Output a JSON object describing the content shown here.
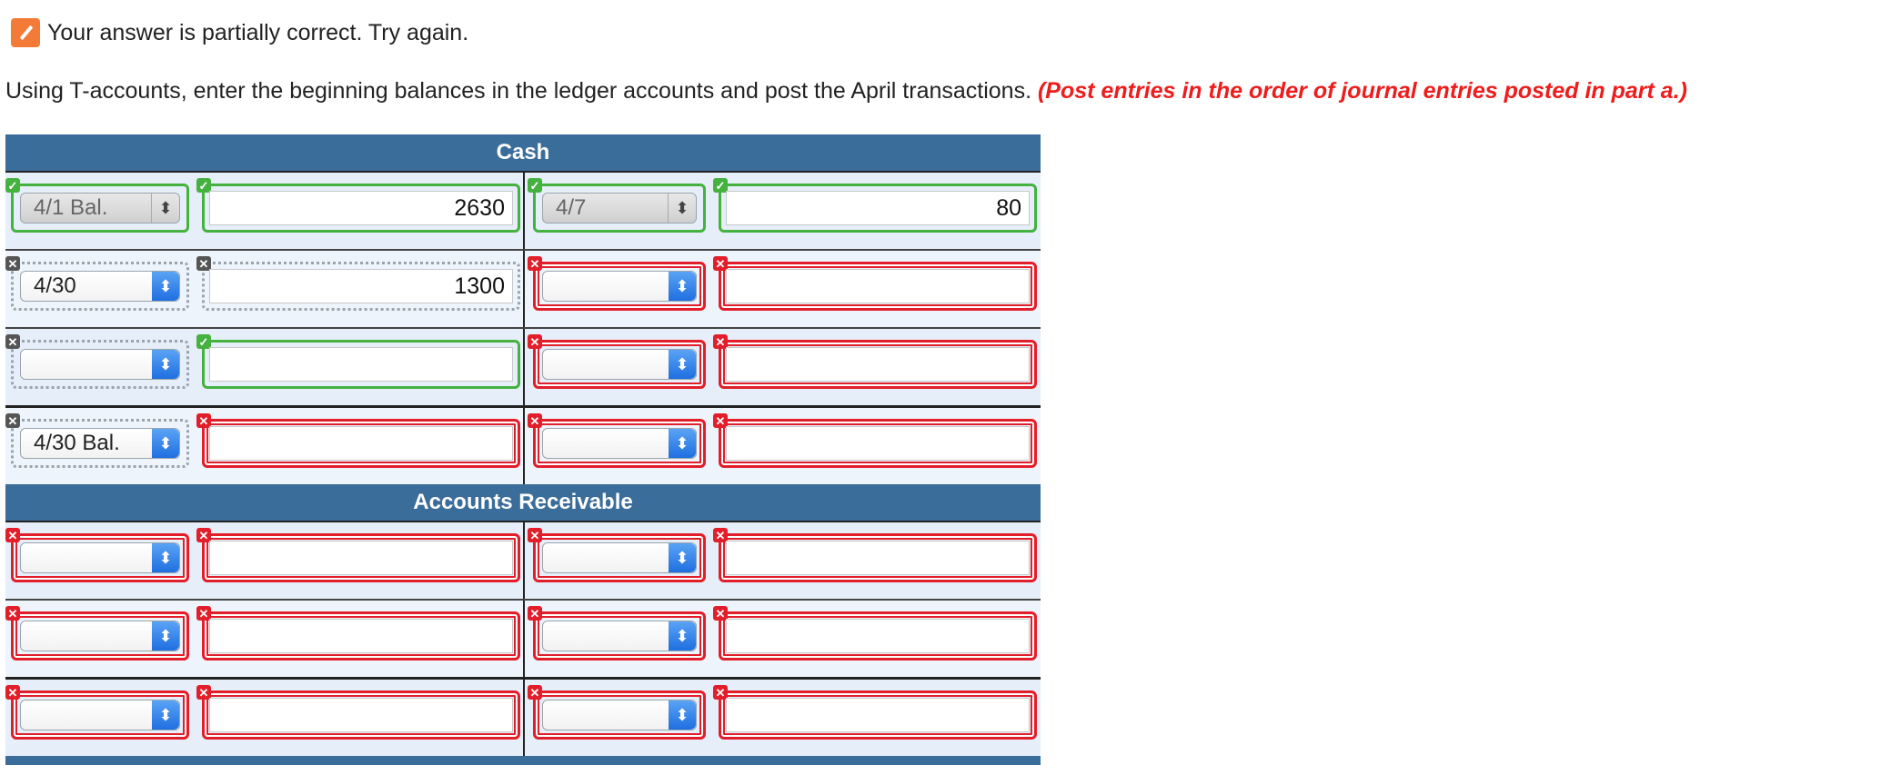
{
  "status": {
    "message": "Your answer is partially correct.  Try again.",
    "color": "#f47b37"
  },
  "instructions": {
    "text": "Using T-accounts, enter the beginning balances in the ledger accounts and post the April transactions.",
    "hint": "(Post entries in the order of journal entries posted in part a.)"
  },
  "colors": {
    "header": "#3b6d9a",
    "correct": "#45b23f",
    "incorrect": "#e21e2a"
  },
  "accounts": [
    {
      "title": "Cash",
      "rows": [
        {
          "debit_label": "4/1 Bal.",
          "debit_amount": "2630",
          "credit_label": "4/7",
          "credit_amount": "80"
        },
        {
          "debit_label": "4/30",
          "debit_amount": "1300",
          "credit_label": "",
          "credit_amount": ""
        },
        {
          "debit_label": "",
          "debit_amount": "",
          "credit_label": "",
          "credit_amount": ""
        },
        {
          "debit_label": "4/30 Bal.",
          "debit_amount": "",
          "credit_label": "",
          "credit_amount": ""
        }
      ]
    },
    {
      "title": "Accounts Receivable",
      "rows": [
        {
          "debit_label": "",
          "debit_amount": "",
          "credit_label": "",
          "credit_amount": ""
        },
        {
          "debit_label": "",
          "debit_amount": "",
          "credit_label": "",
          "credit_amount": ""
        },
        {
          "debit_label": "",
          "debit_amount": "",
          "credit_label": "",
          "credit_amount": ""
        }
      ]
    }
  ]
}
